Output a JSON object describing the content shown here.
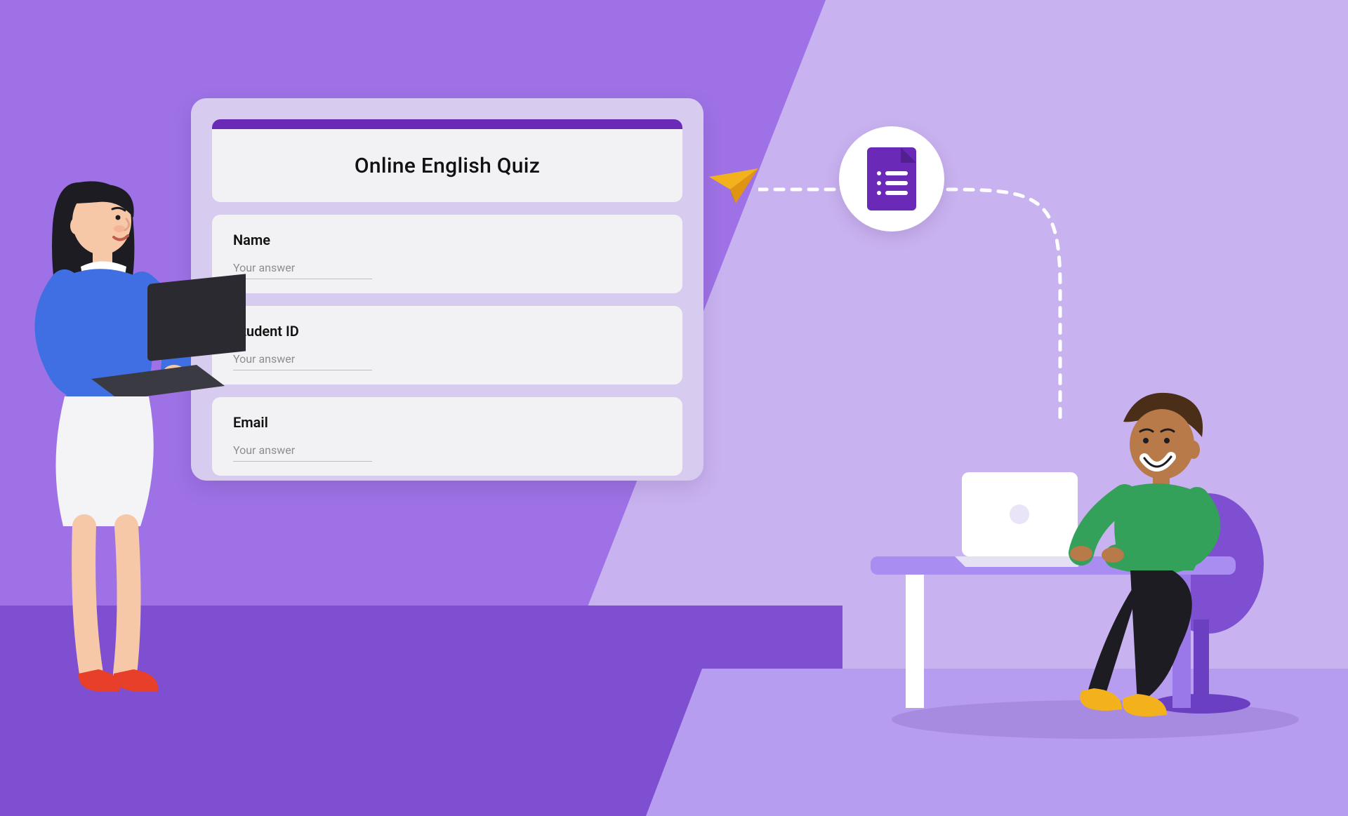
{
  "form": {
    "title": "Online English Quiz",
    "fields": [
      {
        "label": "Name",
        "placeholder": "Your answer"
      },
      {
        "label": "Student ID",
        "placeholder": "Your answer"
      },
      {
        "label": "Email",
        "placeholder": "Your answer"
      }
    ]
  },
  "icons": {
    "paper_plane": "paper-plane-icon",
    "forms": "google-forms-icon"
  },
  "colors": {
    "bg_left": "#9e72e6",
    "bg_right": "#c9b2f0",
    "accent": "#6a29b6",
    "floor_left": "#7e4fd1",
    "floor_right": "#b79df0"
  }
}
